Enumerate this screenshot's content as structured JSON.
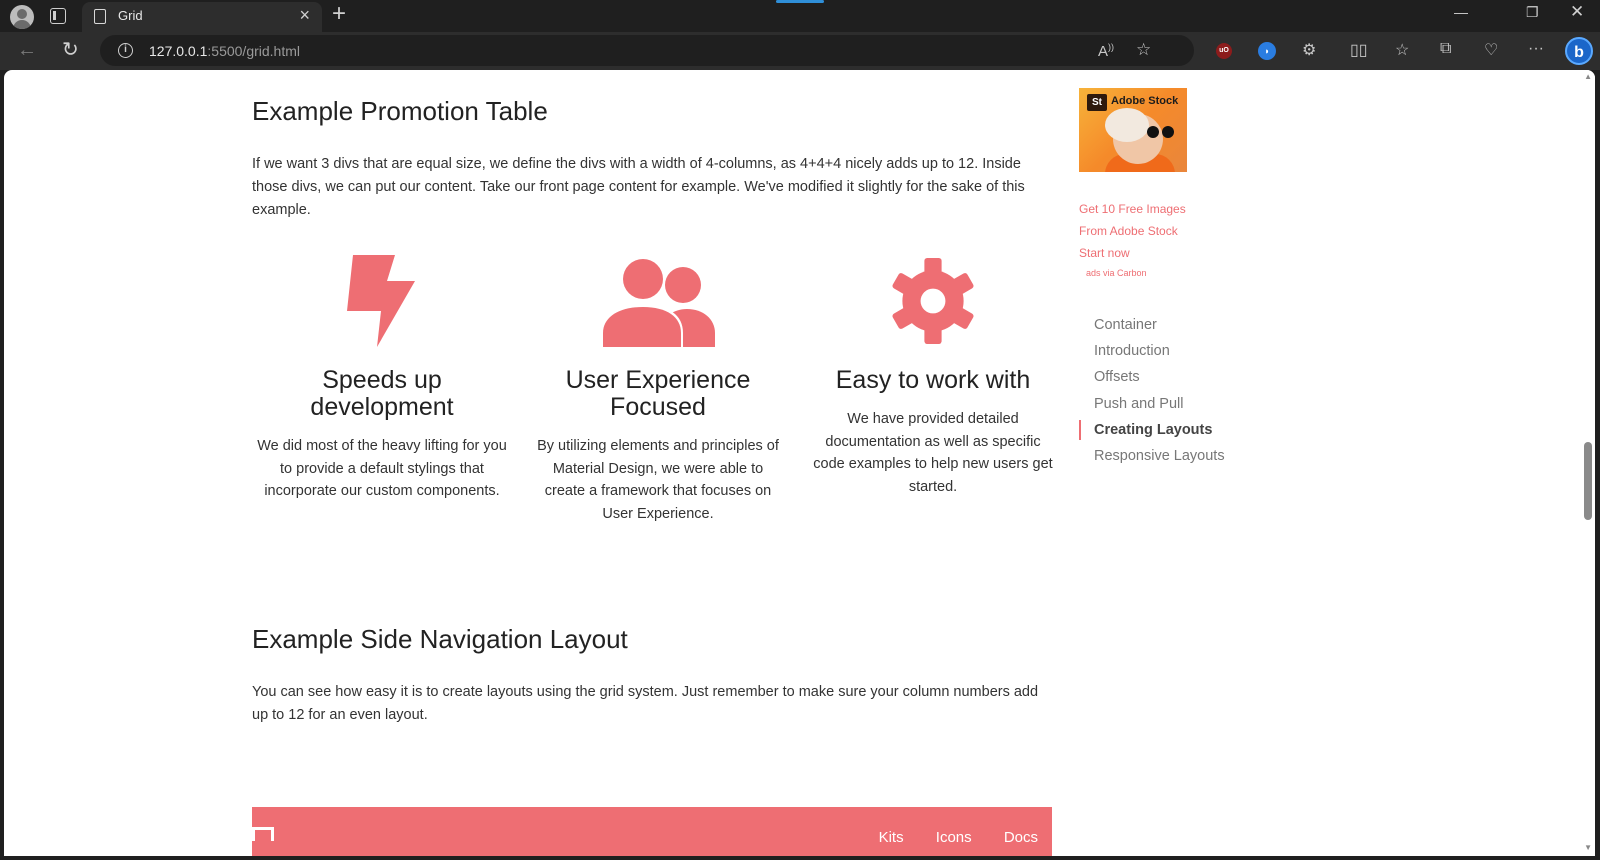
{
  "browser": {
    "tab_title": "Grid",
    "url_host": "127.0.0.1",
    "url_path": ":5500/grid.html",
    "ext_ublock_label": "uO"
  },
  "promo": {
    "heading": "Example Promotion Table",
    "intro": "If we want 3 divs that are equal size, we define the divs with a width of 4-columns, as 4+4+4 nicely adds up to 12. Inside those divs, we can put our content. Take our front page content for example. We've modified it slightly for the sake of this example.",
    "features": [
      {
        "icon": "bolt-icon",
        "title": "Speeds up development",
        "text": "We did most of the heavy lifting for you to provide a default stylings that incorporate our custom components."
      },
      {
        "icon": "group-icon",
        "title": "User Experience Focused",
        "text": "By utilizing elements and principles of Material Design, we were able to create a framework that focuses on User Experience."
      },
      {
        "icon": "settings-icon",
        "title": "Easy to work with",
        "text": "We have provided detailed documentation as well as specific code examples to help new users get started."
      }
    ]
  },
  "sidenav": {
    "heading": "Example Side Navigation Layout",
    "intro": "You can see how easy it is to create layouts using the grid system. Just remember to make sure your column numbers add up to 12 for an even layout."
  },
  "demo_nav": {
    "links": [
      "Kits",
      "Icons",
      "Docs"
    ]
  },
  "ad": {
    "brand": "Adobe Stock",
    "logo_text": "St",
    "lines": [
      "Get 10 Free Images",
      "From Adobe Stock",
      "Start now"
    ],
    "via": "ads via Carbon"
  },
  "toc": {
    "items": [
      "Container",
      "Introduction",
      "Offsets",
      "Push and Pull",
      "Creating Layouts",
      "Responsive Layouts"
    ],
    "active": "Creating Layouts"
  },
  "colors": {
    "accent": "#ee6e73",
    "text": "#333333"
  }
}
